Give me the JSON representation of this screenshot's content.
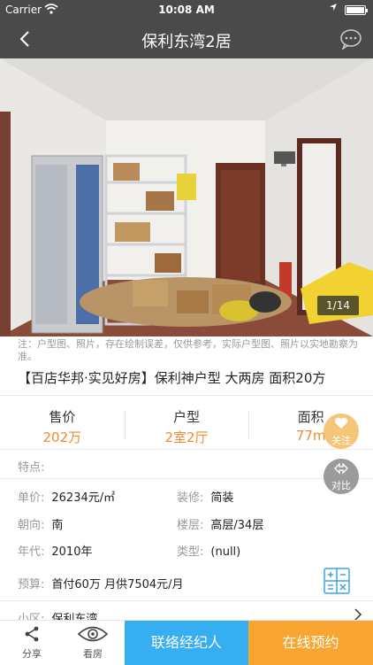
{
  "status_bar": {
    "carrier": "Carrier",
    "time": "10:08 AM"
  },
  "nav": {
    "title": "保利东湾2居"
  },
  "gallery": {
    "counter": "1/14"
  },
  "disclaimer": "注：户型图、照片，存在绘制误差，仅供参考，实际户型图、照片以实地勘察为准。",
  "listing": {
    "title": "【百店华邦·实见好房】保利神户型 大两房 面积20方"
  },
  "key_stats": [
    {
      "label": "售价",
      "value": "202万"
    },
    {
      "label": "户型",
      "value": "2室2厅"
    },
    {
      "label": "面积",
      "value": "77m"
    }
  ],
  "features": {
    "label": "特点:"
  },
  "details": {
    "unit_price": {
      "label": "单价:",
      "value": "26234元/㎡"
    },
    "decoration": {
      "label": "装修:",
      "value": "简装"
    },
    "orientation": {
      "label": "朝向:",
      "value": "南"
    },
    "floor": {
      "label": "楼层:",
      "value": "高层/34层"
    },
    "year": {
      "label": "年代:",
      "value": "2010年"
    },
    "type": {
      "label": "类型:",
      "value": "(null)"
    },
    "budget": {
      "label": "预算:",
      "value": "首付60万 月供7504元/月"
    },
    "community": {
      "label": "小区:",
      "value": "保利东湾"
    }
  },
  "float_buttons": {
    "follow": "关注",
    "compare": "对比"
  },
  "bottom_bar": {
    "share": "分享",
    "view": "看房",
    "contact_agent": "联络经纪人",
    "online_appointment": "在线预约"
  },
  "colors": {
    "accent_orange": "#f08b2e",
    "agent_blue": "#35aef2",
    "appoint_orange": "#f8a531",
    "nav_bg": "#4a4a4a"
  },
  "icons": [
    "wifi-icon",
    "location-arrow-icon",
    "battery-icon",
    "back-chevron-icon",
    "chat-bubble-icon",
    "heart-icon",
    "compare-icon",
    "calculator-icon",
    "chevron-right-icon",
    "share-icon",
    "eye-icon"
  ]
}
